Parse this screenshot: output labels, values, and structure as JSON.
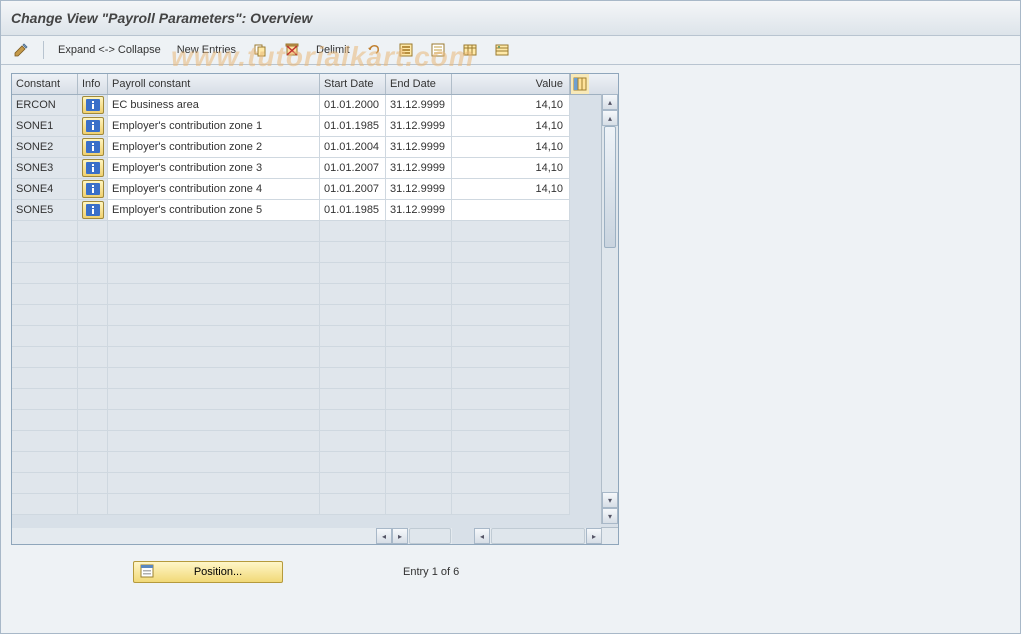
{
  "title": "Change View \"Payroll Parameters\": Overview",
  "toolbar": {
    "expand_collapse": "Expand <-> Collapse",
    "new_entries": "New Entries",
    "delimit": "Delimit"
  },
  "watermark": "www.tutorialkart.com",
  "table": {
    "headers": {
      "constant": "Constant",
      "info": "Info",
      "payroll_constant": "Payroll constant",
      "start_date": "Start Date",
      "end_date": "End Date",
      "value": "Value"
    },
    "rows": [
      {
        "constant": "ERCON",
        "payroll_constant": "EC business area",
        "start": "01.01.2000",
        "end": "31.12.9999",
        "value": "14,10"
      },
      {
        "constant": "SONE1",
        "payroll_constant": "Employer's contribution zone 1",
        "start": "01.01.1985",
        "end": "31.12.9999",
        "value": "14,10"
      },
      {
        "constant": "SONE2",
        "payroll_constant": "Employer's contribution zone 2",
        "start": "01.01.2004",
        "end": "31.12.9999",
        "value": "14,10"
      },
      {
        "constant": "SONE3",
        "payroll_constant": "Employer's contribution zone 3",
        "start": "01.01.2007",
        "end": "31.12.9999",
        "value": "14,10"
      },
      {
        "constant": "SONE4",
        "payroll_constant": "Employer's contribution zone 4",
        "start": "01.01.2007",
        "end": "31.12.9999",
        "value": "14,10"
      },
      {
        "constant": "SONE5",
        "payroll_constant": "Employer's contribution zone 5",
        "start": "01.01.1985",
        "end": "31.12.9999",
        "value": ""
      }
    ],
    "empty_rows": 14
  },
  "footer": {
    "position_button": "Position...",
    "entry_text": "Entry 1 of 6"
  },
  "icons": {
    "pencil": "pencil-icon",
    "copy": "copy-icon",
    "delete": "delete-icon",
    "undo": "undo-icon",
    "select_all": "select-all-icon",
    "deselect_all": "deselect-all-icon",
    "table_settings1": "table-settings-icon",
    "table_settings2": "print-icon",
    "info": "info-icon",
    "configure_columns": "configure-columns-icon",
    "position_icon": "position-icon"
  }
}
